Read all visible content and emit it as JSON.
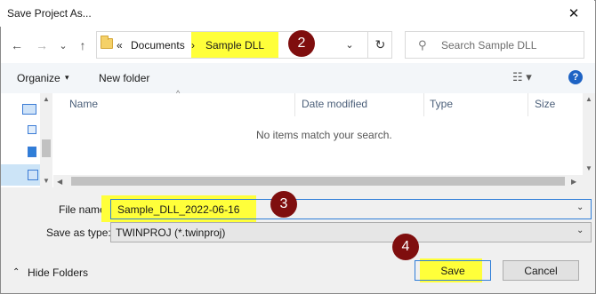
{
  "window": {
    "title": "Save Project As...",
    "close_glyph": "✕"
  },
  "nav": {
    "back_icon": "←",
    "forward_icon": "→",
    "recent_icon": "⌄",
    "up_icon": "↑"
  },
  "address": {
    "overflow": "«",
    "crumbs": [
      "Documents",
      "Sample DLL"
    ],
    "separator": "›",
    "dropdown_icon": "⌄",
    "refresh_icon": "↻"
  },
  "search": {
    "placeholder": "Search Sample DLL",
    "icon": "⚲"
  },
  "toolbar": {
    "organize": "Organize",
    "organize_caret": "▾",
    "new_folder": "New folder",
    "view_icon": "☷ ▾",
    "help": "?"
  },
  "columns": [
    "Name",
    "Date modified",
    "Type",
    "Size"
  ],
  "list": {
    "empty_message": "No items match your search."
  },
  "form": {
    "file_name_label": "File name:",
    "file_name_value": "Sample_DLL_2022-06-16",
    "save_type_label": "Save as type:",
    "save_type_value": "TWINPROJ (*.twinproj)",
    "dropdown_caret": "⌄"
  },
  "footer": {
    "hide_folders": "Hide Folders",
    "hide_caret": "⌃",
    "save": "Save",
    "cancel": "Cancel"
  },
  "callouts": [
    "2",
    "3",
    "4"
  ],
  "colors": {
    "highlight": "#ffff3a",
    "callout": "#7f0e0e",
    "accent": "#2f7ed8"
  }
}
